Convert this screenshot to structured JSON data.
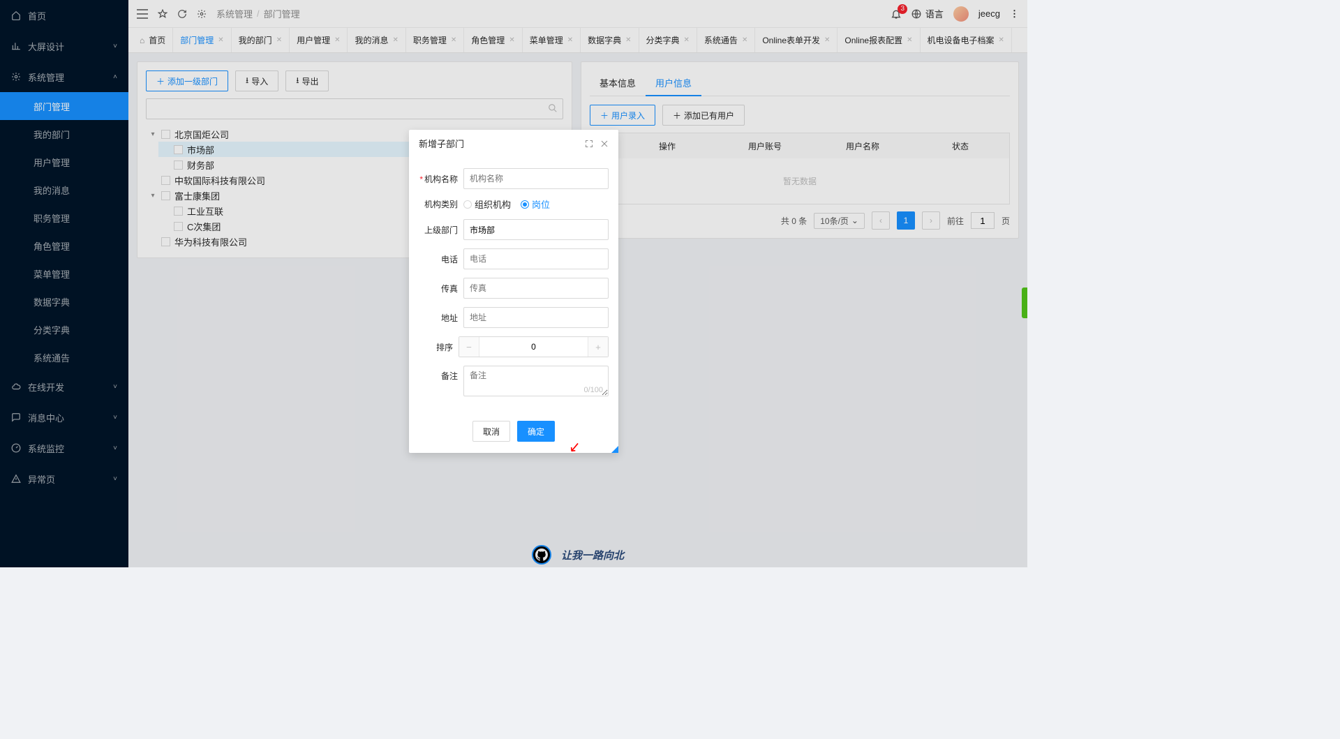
{
  "sidebar": {
    "items": [
      {
        "label": "首页",
        "icon": "home",
        "arrow": null
      },
      {
        "label": "大屏设计",
        "icon": "chart",
        "arrow": "down"
      },
      {
        "label": "系统管理",
        "icon": "gear",
        "arrow": "up",
        "expanded": true,
        "children": [
          {
            "label": "部门管理",
            "active": true
          },
          {
            "label": "我的部门"
          },
          {
            "label": "用户管理"
          },
          {
            "label": "我的消息"
          },
          {
            "label": "职务管理"
          },
          {
            "label": "角色管理"
          },
          {
            "label": "菜单管理"
          },
          {
            "label": "数据字典"
          },
          {
            "label": "分类字典"
          },
          {
            "label": "系统通告"
          }
        ]
      },
      {
        "label": "在线开发",
        "icon": "cloud",
        "arrow": "down"
      },
      {
        "label": "消息中心",
        "icon": "message",
        "arrow": "down"
      },
      {
        "label": "系统监控",
        "icon": "dashboard",
        "arrow": "down"
      },
      {
        "label": "异常页",
        "icon": "warning",
        "arrow": "down"
      }
    ]
  },
  "topbar": {
    "breadcrumb": [
      "系统管理",
      "部门管理"
    ],
    "badge": "3",
    "language": "语言",
    "username": "jeecg"
  },
  "tabs": [
    {
      "label": "首页",
      "home": true
    },
    {
      "label": "部门管理",
      "active": true
    },
    {
      "label": "我的部门"
    },
    {
      "label": "用户管理"
    },
    {
      "label": "我的消息"
    },
    {
      "label": "职务管理"
    },
    {
      "label": "角色管理"
    },
    {
      "label": "菜单管理"
    },
    {
      "label": "数据字典"
    },
    {
      "label": "分类字典"
    },
    {
      "label": "系统通告"
    },
    {
      "label": "Online表单开发"
    },
    {
      "label": "Online报表配置"
    },
    {
      "label": "机电设备电子档案"
    }
  ],
  "leftPanel": {
    "buttons": {
      "add": "添加一级部门",
      "import": "导入",
      "export": "导出"
    },
    "search_placeholder": "",
    "tree": [
      {
        "label": "北京国炬公司",
        "children": [
          {
            "label": "市场部",
            "selected": true
          },
          {
            "label": "财务部"
          }
        ]
      },
      {
        "label": "中软国际科技有限公司"
      },
      {
        "label": "富士康集团",
        "children": [
          {
            "label": "工业互联"
          },
          {
            "label": "C次集团"
          }
        ]
      },
      {
        "label": "华为科技有限公司"
      }
    ]
  },
  "rightPanel": {
    "tabs": [
      {
        "label": "基本信息"
      },
      {
        "label": "用户信息",
        "active": true
      }
    ],
    "buttons": {
      "enroll": "用户录入",
      "addExisting": "添加已有用户"
    },
    "columns": [
      "操作",
      "用户账号",
      "用户名称",
      "状态"
    ],
    "empty": "暂无数据",
    "pager": {
      "total": "共 0 条",
      "perPage": "10条/页",
      "current": "1",
      "goto": "前往",
      "gotoVal": "1",
      "pageSuffix": "页"
    }
  },
  "modal": {
    "title": "新增子部门",
    "labels": {
      "name": "机构名称",
      "type": "机构类别",
      "parent": "上级部门",
      "phone": "电话",
      "fax": "传真",
      "address": "地址",
      "sort": "排序",
      "remark": "备注"
    },
    "placeholders": {
      "name": "机构名称",
      "phone": "电话",
      "fax": "传真",
      "address": "地址",
      "remark": "备注"
    },
    "typeOptions": {
      "org": "组织机构",
      "post": "岗位"
    },
    "parentValue": "市场部",
    "sortValue": "0",
    "remarkCount": "0/100",
    "buttons": {
      "cancel": "取消",
      "ok": "确定"
    }
  },
  "footer": {
    "text": "让我一路向北"
  }
}
